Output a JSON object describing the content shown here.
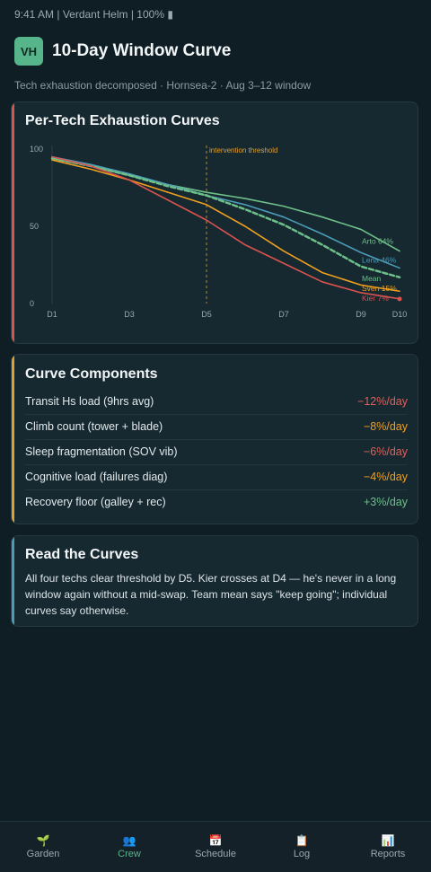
{
  "status_bar": {
    "text": "9:41 AM | Verdant Helm | 100% ▮"
  },
  "header": {
    "badge": "VH",
    "title": "10-Day Window Curve"
  },
  "subtitle": "Tech exhaustion decomposed · Hornsea-2 · Aug 3–12 window",
  "chart_card": {
    "title": "Per-Tech Exhaustion Curves",
    "accent_color": "#d9534f"
  },
  "chart_data": {
    "type": "line",
    "title": "Per-Tech Exhaustion Curves",
    "x_tick_labels": [
      "D1",
      "D3",
      "D5",
      "D7",
      "D9",
      "D10"
    ],
    "x_tick_days": [
      1,
      3,
      5,
      7,
      9,
      10
    ],
    "y_ticks": [
      0,
      50,
      100
    ],
    "ylim": [
      0,
      100
    ],
    "xlim": [
      1,
      10
    ],
    "grid": false,
    "threshold": {
      "day": 5,
      "label": "intervention threshold",
      "color": "#e0a030"
    },
    "x": [
      1,
      2,
      3,
      4,
      5,
      6,
      7,
      8,
      9,
      10
    ],
    "series": [
      {
        "name": "Arto",
        "end_label": "Arto 64%",
        "color": "#6ec08a",
        "dashed": false,
        "values": [
          94,
          89,
          83,
          77,
          72,
          68,
          63,
          56,
          48,
          34
        ]
      },
      {
        "name": "Lena",
        "end_label": "Lena 46%",
        "color": "#4a9cb8",
        "dashed": false,
        "values": [
          95,
          90,
          84,
          77,
          70,
          64,
          56,
          45,
          33,
          23
        ]
      },
      {
        "name": "Mean",
        "end_label": "Mean",
        "color": "#6ec08a",
        "dashed": true,
        "values": [
          94,
          89,
          83,
          76,
          70,
          61,
          51,
          38,
          24,
          17
        ]
      },
      {
        "name": "Sven",
        "end_label": "Sven 15%",
        "color": "#f0a020",
        "dashed": false,
        "values": [
          93,
          87,
          80,
          72,
          64,
          50,
          34,
          20,
          12,
          8
        ]
      },
      {
        "name": "Kier",
        "end_label": "Kier 7%",
        "color": "#d9534f",
        "dashed": false,
        "values": [
          95,
          89,
          80,
          67,
          54,
          38,
          26,
          14,
          7,
          3
        ]
      }
    ]
  },
  "components_card": {
    "title": "Curve Components",
    "accent_color": "#e0a030",
    "rows": [
      {
        "label": "Transit Hs load (9hrs avg)",
        "value": "−12%/day",
        "color": "#e0605a"
      },
      {
        "label": "Climb count (tower + blade)",
        "value": "−8%/day",
        "color": "#f0a020"
      },
      {
        "label": "Sleep fragmentation (SOV vib)",
        "value": "−6%/day",
        "color": "#e0605a"
      },
      {
        "label": "Cognitive load (failures diag)",
        "value": "−4%/day",
        "color": "#f0a020"
      },
      {
        "label": "Recovery floor (galley + rec)",
        "value": "+3%/day",
        "color": "#6ec08a"
      }
    ]
  },
  "read_card": {
    "title": "Read the Curves",
    "accent_color": "#4a9cb8",
    "body": "All four techs clear threshold by D5. Kier crosses at D4 — he's never in a long window again without a mid-swap. Team mean says \"keep going\"; individual curves say otherwise."
  },
  "bottom_nav": {
    "items": [
      {
        "label": "Garden",
        "icon": "🌱",
        "icon_name": "sprout-icon",
        "active": false
      },
      {
        "label": "Crew",
        "icon": "👥",
        "icon_name": "crew-icon",
        "active": true
      },
      {
        "label": "Schedule",
        "icon": "📅",
        "icon_name": "calendar-icon",
        "active": false
      },
      {
        "label": "Log",
        "icon": "📋",
        "icon_name": "clipboard-icon",
        "active": false
      },
      {
        "label": "Reports",
        "icon": "📊",
        "icon_name": "bar-chart-icon",
        "active": false
      }
    ]
  }
}
